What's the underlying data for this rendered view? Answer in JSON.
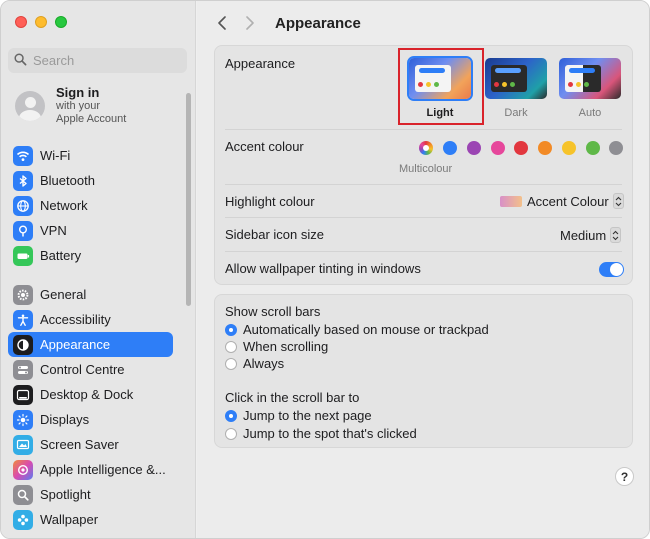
{
  "window": {
    "title": "Appearance"
  },
  "search": {
    "placeholder": "Search",
    "value": ""
  },
  "account": {
    "title": "Sign in",
    "subtitle_line1": "with your",
    "subtitle_line2": "Apple Account"
  },
  "sidebar": {
    "group1": [
      {
        "label": "Wi-Fi",
        "icon": "wifi-icon",
        "color": "#2e7ef7"
      },
      {
        "label": "Bluetooth",
        "icon": "bluetooth-icon",
        "color": "#2e7ef7"
      },
      {
        "label": "Network",
        "icon": "globe-icon",
        "color": "#2e7ef7"
      },
      {
        "label": "VPN",
        "icon": "vpn-icon",
        "color": "#2e7ef7"
      },
      {
        "label": "Battery",
        "icon": "battery-icon",
        "color": "#35c759"
      }
    ],
    "group2": [
      {
        "label": "General",
        "icon": "gear-icon",
        "color": "#8e8e93"
      },
      {
        "label": "Accessibility",
        "icon": "accessibility-icon",
        "color": "#2e7ef7"
      },
      {
        "label": "Appearance",
        "icon": "appearance-icon",
        "color": "#1d1d1f",
        "selected": true
      },
      {
        "label": "Control Centre",
        "icon": "control-centre-icon",
        "color": "#8e8e93"
      },
      {
        "label": "Desktop & Dock",
        "icon": "dock-icon",
        "color": "#1d1d1f"
      },
      {
        "label": "Displays",
        "icon": "display-icon",
        "color": "#2e7ef7"
      },
      {
        "label": "Screen Saver",
        "icon": "screen-saver-icon",
        "color": "#32ade6"
      },
      {
        "label": "Apple Intelligence &...",
        "icon": "apple-intelligence-icon",
        "color": "#f08a3a"
      },
      {
        "label": "Spotlight",
        "icon": "spotlight-icon",
        "color": "#8e8e93"
      },
      {
        "label": "Wallpaper",
        "icon": "wallpaper-icon",
        "color": "#32ade6"
      }
    ]
  },
  "appearance": {
    "label": "Appearance",
    "options": [
      {
        "label": "Light",
        "selected": true
      },
      {
        "label": "Dark",
        "selected": false
      },
      {
        "label": "Auto",
        "selected": false
      }
    ]
  },
  "accent": {
    "label": "Accent colour",
    "selected_label": "Multicolour",
    "colors": [
      "multicolour",
      "#2e7ef7",
      "#9b45b3",
      "#e6479b",
      "#e2373f",
      "#f28a26",
      "#f6c32a",
      "#5fb848",
      "#8e8e93"
    ]
  },
  "highlight": {
    "label": "Highlight colour",
    "value": "Accent Colour"
  },
  "sidebar_icon_size": {
    "label": "Sidebar icon size",
    "value": "Medium"
  },
  "wallpaper_tinting": {
    "label": "Allow wallpaper tinting in windows",
    "enabled": true
  },
  "scroll_bars": {
    "label": "Show scroll bars",
    "options": [
      {
        "label": "Automatically based on mouse or trackpad",
        "selected": true
      },
      {
        "label": "When scrolling",
        "selected": false
      },
      {
        "label": "Always",
        "selected": false
      }
    ]
  },
  "click_scroll": {
    "label": "Click in the scroll bar to",
    "options": [
      {
        "label": "Jump to the next page",
        "selected": true
      },
      {
        "label": "Jump to the spot that's clicked",
        "selected": false
      }
    ]
  },
  "help": {
    "label": "?"
  }
}
